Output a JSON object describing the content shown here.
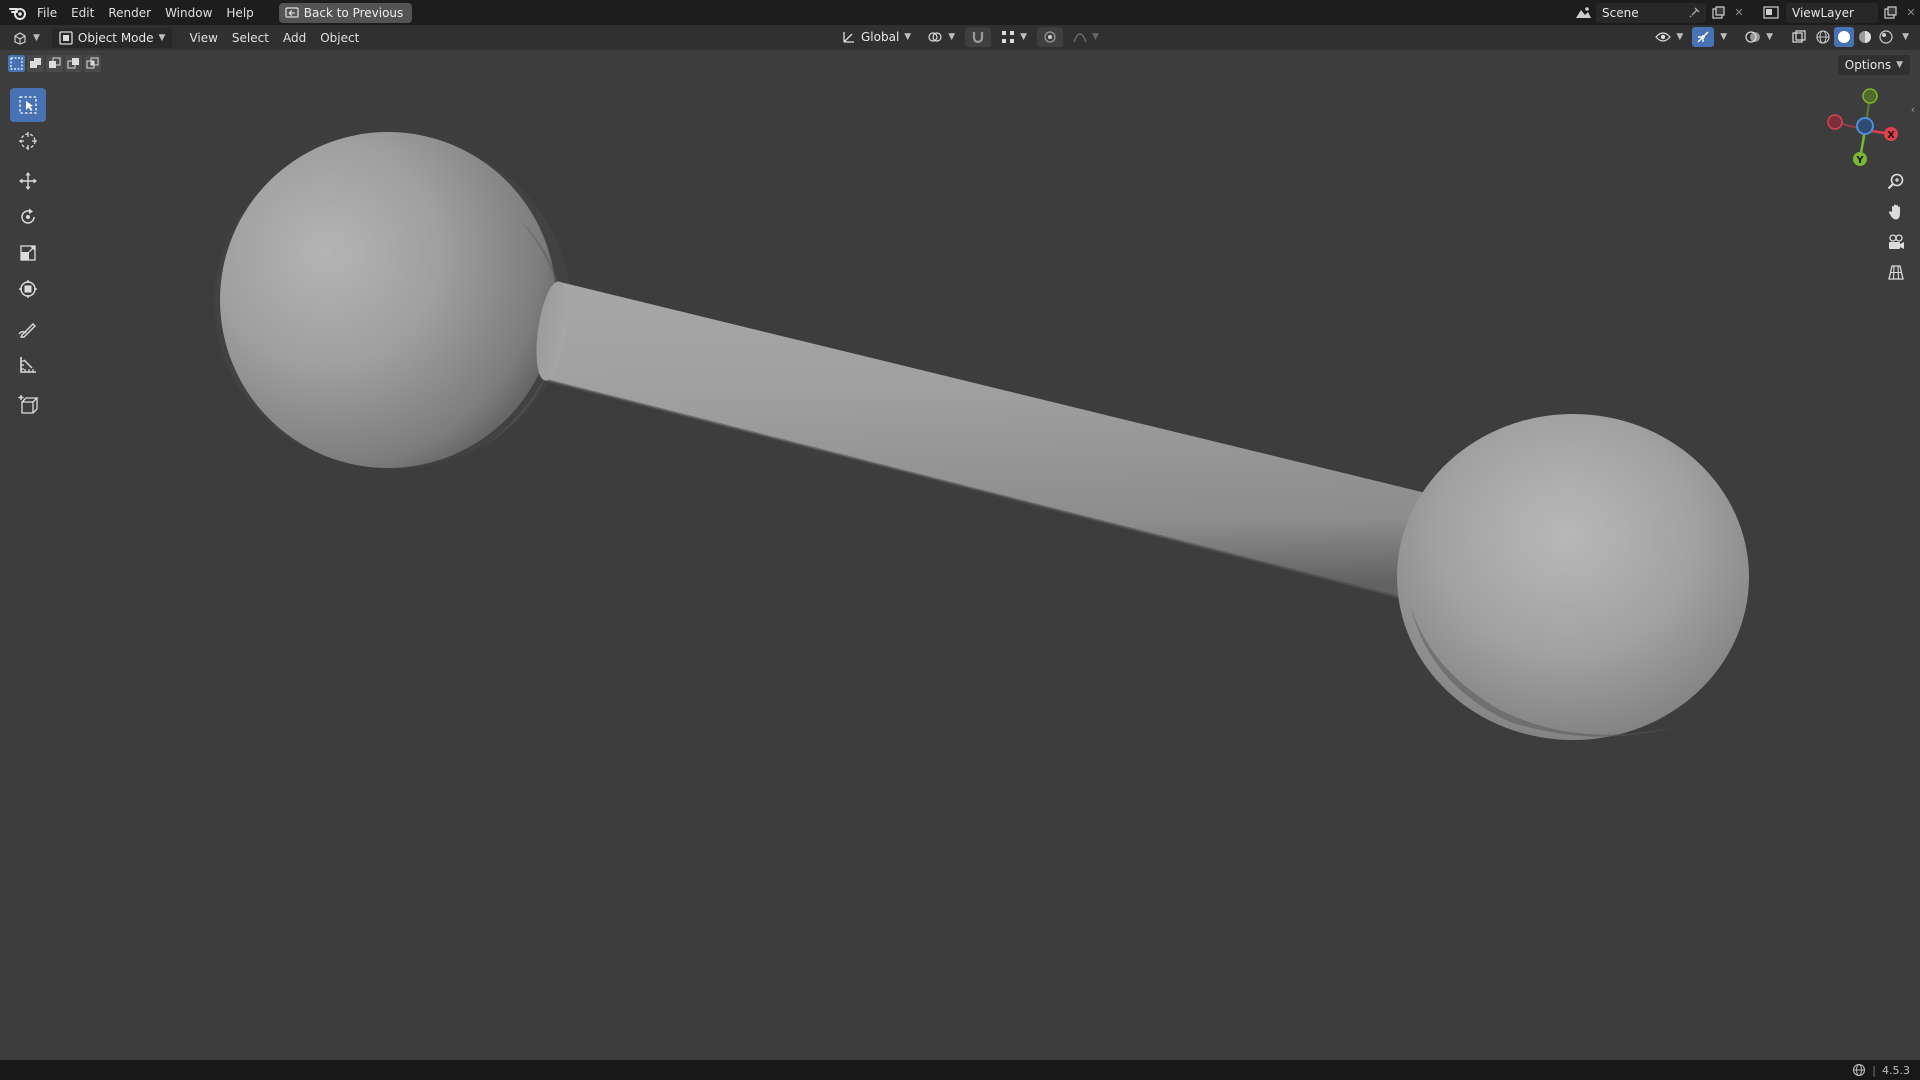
{
  "app": {
    "menu": [
      "File",
      "Edit",
      "Render",
      "Window",
      "Help"
    ],
    "back_button": "Back to Previous"
  },
  "top_right": {
    "scene": "Scene",
    "view_layer": "ViewLayer"
  },
  "header": {
    "mode": "Object Mode",
    "menus": [
      "View",
      "Select",
      "Add",
      "Object"
    ],
    "transform_orientation": "Global"
  },
  "viewport": {
    "options_label": "Options",
    "gizmo": {
      "x_label": "X",
      "y_label": "Y"
    },
    "accent": "#4772b3",
    "x_color": "#e0404f",
    "y_color": "#7cb82f",
    "z_color": "#4a8fdc"
  },
  "status": {
    "version": "4.5.3"
  },
  "icons": [
    "blender-logo",
    "select-box-icon",
    "cursor-icon",
    "move-icon",
    "rotate-icon",
    "scale-icon",
    "transform-icon",
    "annotate-icon",
    "measure-icon",
    "add-cube-icon",
    "zoom-icon",
    "hand-icon",
    "camera-icon",
    "grid-icon"
  ]
}
